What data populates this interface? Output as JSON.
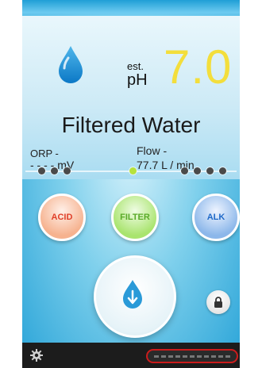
{
  "reading": {
    "est_label": "est.",
    "ph_label": "pH",
    "ph_value": "7.0"
  },
  "mode_title": "Filtered Water",
  "orp": {
    "label": "ORP -",
    "value": "- - - - mV"
  },
  "flow": {
    "label": "Flow -",
    "value": "77.7   L / min"
  },
  "level_indicator": {
    "total": 8,
    "active_index": 3
  },
  "modes": {
    "acid": "ACID",
    "filter": "FILTER",
    "alk": "ALK"
  },
  "icons": {
    "water": "water-drop-icon",
    "dispense": "dispense-drop-icon",
    "lock": "lock-icon",
    "settings": "gear-icon"
  },
  "colors": {
    "ph_value": "#f3de3c",
    "acid": "#e0402a",
    "filter": "#5aaa2a",
    "alk": "#1f69c8",
    "active_dot": "#b6e23c",
    "status_outline": "#cc1c1c"
  }
}
